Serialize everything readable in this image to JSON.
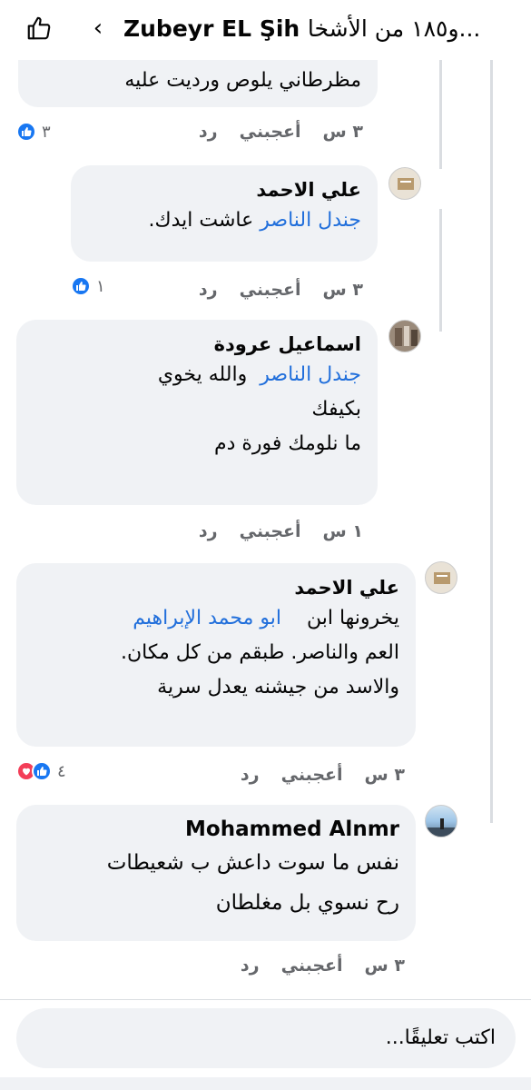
{
  "header": {
    "title_name": "Zubeyr EL Şih",
    "title_rest": "و١٨٥ من الأشخا...",
    "like_icon": "thumbs-up-outline-icon",
    "back_icon": "chevron-left-icon"
  },
  "comments": [
    {
      "author": "",
      "text_lines": [
        "مظرطاني يلوص ورديت عليه"
      ],
      "time": "٣ س",
      "like_label": "أعجبني",
      "reply_label": "رد",
      "reaction_count": "٣"
    },
    {
      "author": "علي الاحمد",
      "mention": "جندل الناصر",
      "text_after_mention": "عاشت ايدك.",
      "time": "٣ س",
      "like_label": "أعجبني",
      "reply_label": "رد",
      "reaction_count": "١"
    },
    {
      "author": "اسماعيل عرودة",
      "mention": "جندل الناصر",
      "text_after_mention": "والله يخوي",
      "text_lines": [
        "بكيفك",
        "ما نلومك فورة دم"
      ],
      "time": "١ س",
      "like_label": "أعجبني",
      "reply_label": "رد"
    },
    {
      "author": "علي الاحمد",
      "mention": "ابو محمد الإبراهيم",
      "text_after_mention": "يخرونها ابن",
      "text_lines": [
        "العم والناصر. طبقم من كل مكان.",
        "والاسد من جيشنه يعدل سرية"
      ],
      "time": "٣ س",
      "like_label": "أعجبني",
      "reply_label": "رد",
      "reaction_count": "٤"
    },
    {
      "author": "Mohammed Alnmr",
      "text_lines": [
        "نفس ما سوت داعش ب شعيطات",
        "رح نسوي بل مغلطان"
      ],
      "time": "٣ س",
      "like_label": "أعجبني",
      "reply_label": "رد"
    }
  ],
  "composer": {
    "placeholder": "اكتب تعليقًا..."
  },
  "colors": {
    "bubble": "#f0f2f5",
    "mention": "#216fdb",
    "meta": "#65676b",
    "like_blue": "#1877f2",
    "love_red": "#f33e58"
  }
}
